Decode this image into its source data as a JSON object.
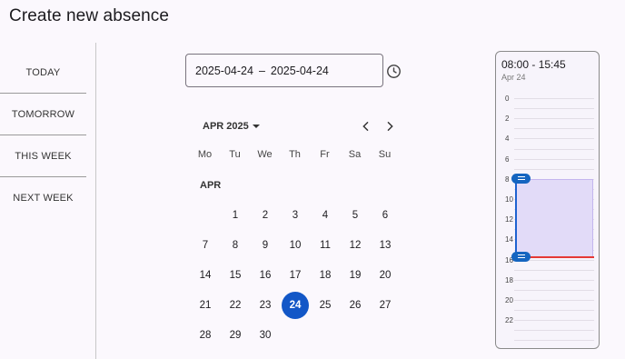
{
  "page": {
    "title": "Create new absence"
  },
  "quick": [
    "TODAY",
    "TOMORROW",
    "THIS WEEK",
    "NEXT WEEK"
  ],
  "range": {
    "start": "2025-04-24",
    "separator": "–",
    "end": "2025-04-24"
  },
  "calendar": {
    "month_label": "APR 2025",
    "weekdays": [
      "Mo",
      "Tu",
      "We",
      "Th",
      "Fr",
      "Sa",
      "Su"
    ],
    "section_label": "APR",
    "days": [
      "1",
      "2",
      "3",
      "4",
      "5",
      "6",
      "7",
      "8",
      "9",
      "10",
      "11",
      "12",
      "13",
      "14",
      "15",
      "16",
      "17",
      "18",
      "19",
      "20",
      "21",
      "22",
      "23",
      "24",
      "25",
      "26",
      "27",
      "28",
      "29",
      "30"
    ],
    "selected": "24"
  },
  "timeline": {
    "time_range": "08:00 - 15:45",
    "date": "Apr 24",
    "hours": [
      "0",
      "2",
      "4",
      "6",
      "8",
      "10",
      "12",
      "14",
      "16",
      "18",
      "20",
      "22"
    ]
  }
}
